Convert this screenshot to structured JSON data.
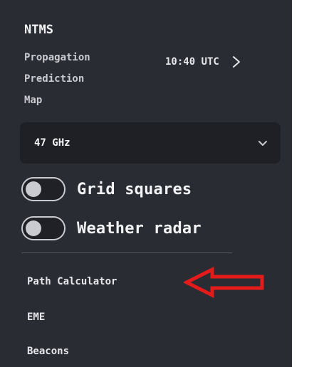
{
  "header": {
    "title": "NTMS",
    "subtitle": "Propagation\nPrediction\nMap",
    "time": "10:40 UTC"
  },
  "frequency_select": {
    "value": "47 GHz"
  },
  "toggles": [
    {
      "label": "Grid squares",
      "on": false
    },
    {
      "label": "Weather radar",
      "on": false
    }
  ],
  "nav": {
    "items": [
      {
        "label": "Path Calculator"
      },
      {
        "label": "EME"
      },
      {
        "label": "Beacons"
      }
    ]
  },
  "colors": {
    "panel_bg": "#2a2c33",
    "select_bg": "#1e2026",
    "annotation_arrow": "#e31b1b"
  },
  "icons": {
    "time_action": "chevron-right-icon",
    "select_indicator": "chevron-down-icon",
    "annotation": "arrow-left-icon"
  }
}
